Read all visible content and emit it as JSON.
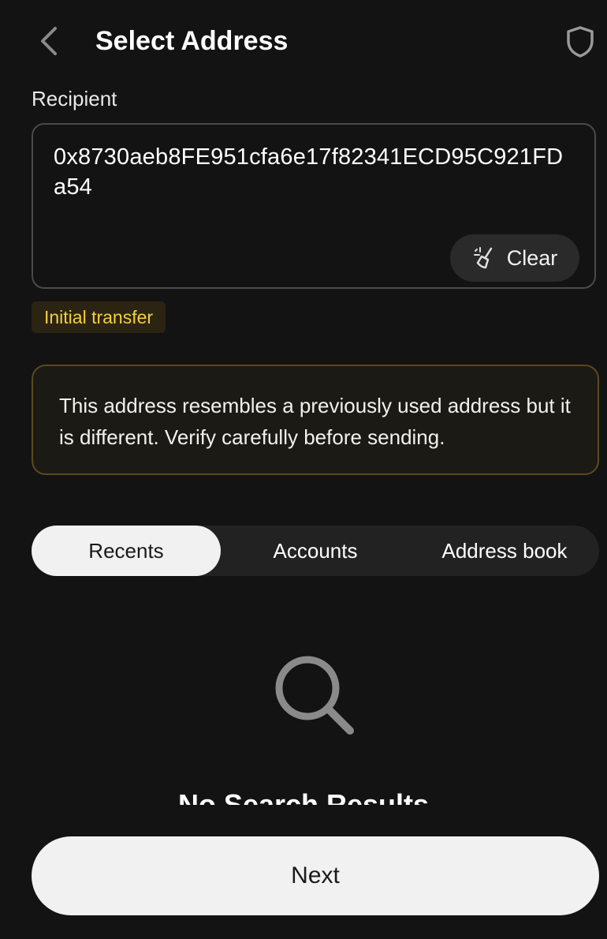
{
  "header": {
    "title": "Select Address",
    "back_icon": "chevron-left-icon",
    "shield_icon": "shield-icon"
  },
  "recipient": {
    "label": "Recipient",
    "address": "0x8730aeb8FE951cfa6e17f82341ECD95C921FDa54",
    "clear_label": "Clear",
    "clear_icon": "broom-icon"
  },
  "tag": {
    "label": "Initial transfer"
  },
  "warning": {
    "text": "This address resembles a previously used address but it is different. Verify carefully before sending."
  },
  "tabs": [
    {
      "label": "Recents",
      "active": true
    },
    {
      "label": "Accounts",
      "active": false
    },
    {
      "label": "Address book",
      "active": false
    }
  ],
  "empty_state": {
    "icon": "search-icon",
    "text": "No Search Results"
  },
  "footer": {
    "next_label": "Next"
  },
  "colors": {
    "background": "#131313",
    "tag_text": "#f3cf3f",
    "warning_border": "#5b4a1f"
  }
}
